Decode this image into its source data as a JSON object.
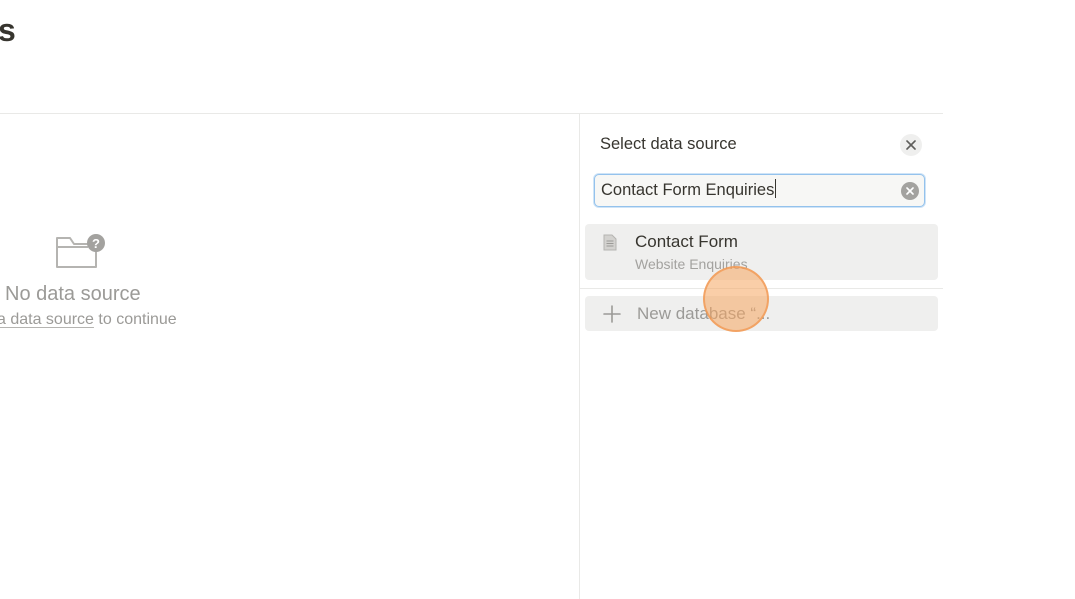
{
  "page": {
    "title_fragment": "s"
  },
  "empty_state": {
    "icon": "folder-question-icon",
    "title": "No data source",
    "link_text": "a data source",
    "suffix_text": "to continue"
  },
  "panel": {
    "title": "Select data source",
    "close_icon": "close-icon",
    "search": {
      "value": "Contact Form Enquiries",
      "clear_icon": "clear-icon"
    },
    "results": [
      {
        "icon": "document-icon",
        "title": "Contact Form",
        "subtitle": "Website Enquiries"
      }
    ],
    "new_database": {
      "icon": "plus-icon",
      "label": "New database “..."
    }
  },
  "colors": {
    "accent_focus": "#94c2ec",
    "hover_bg": "#efefee",
    "muted_text": "#9b9a97",
    "click_indicator": "#f5a660"
  }
}
